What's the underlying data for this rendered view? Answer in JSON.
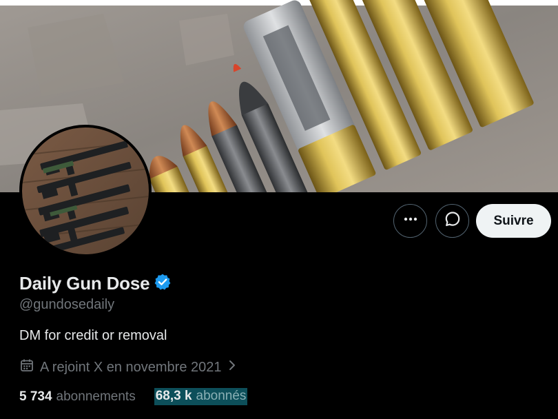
{
  "profile": {
    "display_name": "Daily Gun Dose",
    "verified": true,
    "handle": "@gundosedaily",
    "bio": "DM for credit or removal",
    "joined": "A rejoint X en novembre 2021"
  },
  "actions": {
    "more_icon": "ellipsis-icon",
    "message_icon": "message-icon",
    "follow_label": "Suivre"
  },
  "stats": {
    "following_count": "5 734",
    "following_label": "abonnements",
    "followers_count": "68,3 k",
    "followers_label": "abonnés"
  },
  "colors": {
    "background": "#000000",
    "verified_badge": "#1d9bf0",
    "muted_text": "#71767b",
    "follow_button": "#eff3f4"
  }
}
